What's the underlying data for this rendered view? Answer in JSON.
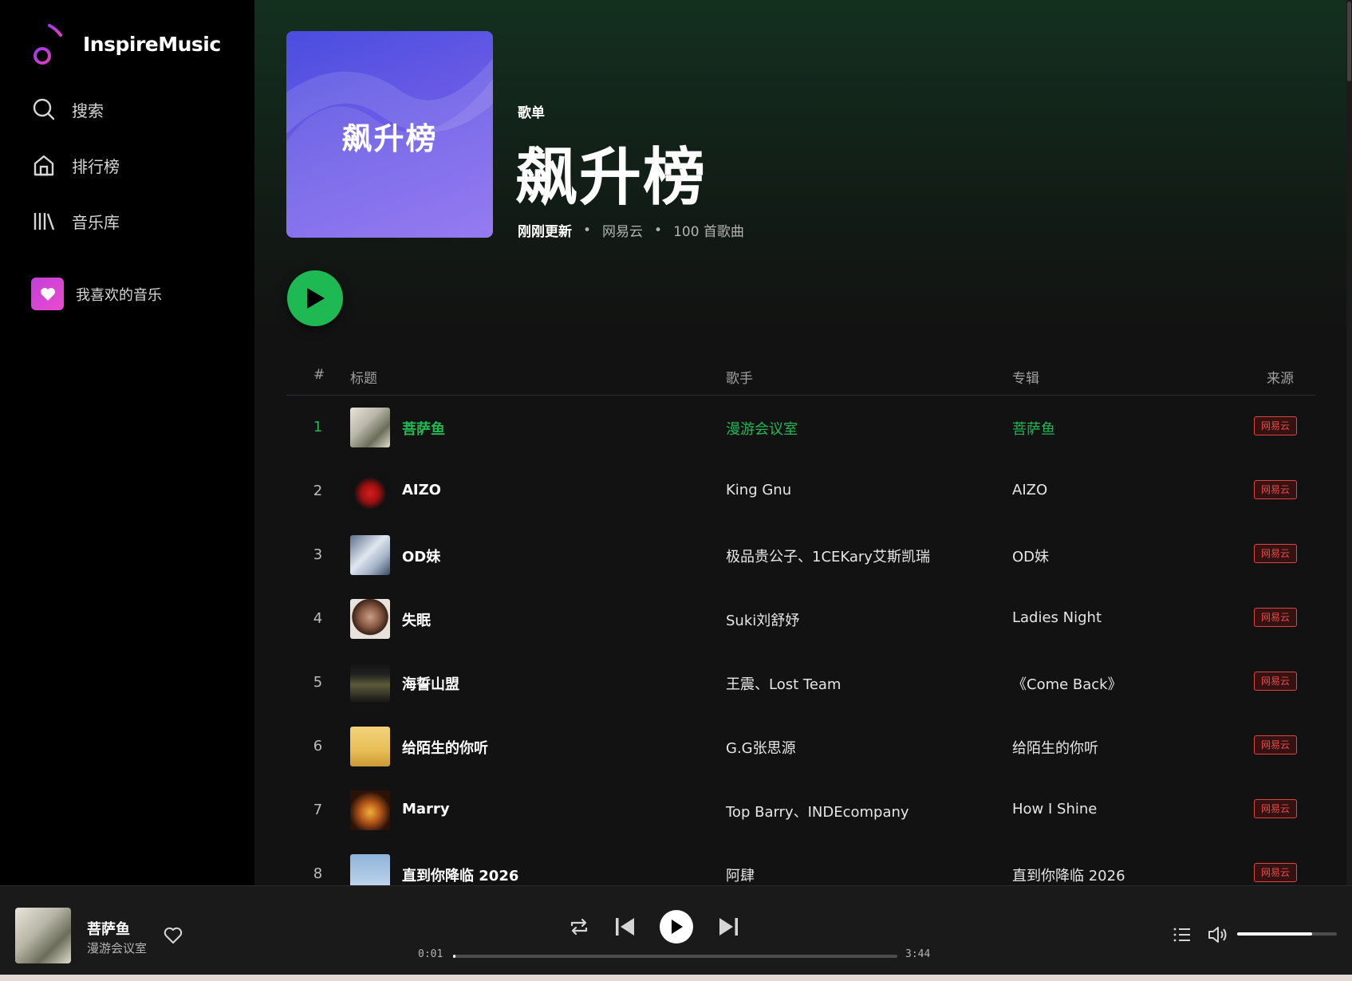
{
  "app": {
    "name": "InspireMusic"
  },
  "sidebar": {
    "nav": [
      {
        "label": "搜索",
        "icon": "search-icon"
      },
      {
        "label": "排行榜",
        "icon": "home-icon"
      },
      {
        "label": "音乐库",
        "icon": "library-icon"
      }
    ],
    "favorite": {
      "label": "我喜欢的音乐",
      "icon": "heart-icon"
    }
  },
  "playlist": {
    "cover_text": "飙升榜",
    "kind": "歌单",
    "title": "飙升榜",
    "updated": "刚刚更新",
    "source": "网易云",
    "count": "100 首歌曲"
  },
  "table": {
    "headers": {
      "num": "#",
      "title": "标题",
      "artist": "歌手",
      "album": "专辑",
      "source": "来源"
    },
    "rows": [
      {
        "num": "1",
        "title": "菩萨鱼",
        "artist": "漫游会议室",
        "album": "菩萨鱼",
        "source": "网易云"
      },
      {
        "num": "2",
        "title": "AIZO",
        "artist": "King Gnu",
        "album": "AIZO",
        "source": "网易云"
      },
      {
        "num": "3",
        "title": "OD妹",
        "artist": "极品贵公子、1CEKary艾斯凯瑞",
        "album": "OD妹",
        "source": "网易云"
      },
      {
        "num": "4",
        "title": "失眠",
        "artist": "Suki刘舒妤",
        "album": "Ladies Night",
        "source": "网易云"
      },
      {
        "num": "5",
        "title": "海誓山盟",
        "artist": "王震、Lost Team",
        "album": "《Come Back》",
        "source": "网易云"
      },
      {
        "num": "6",
        "title": "给陌生的你听",
        "artist": "G.G张思源",
        "album": "给陌生的你听",
        "source": "网易云"
      },
      {
        "num": "7",
        "title": "Marry",
        "artist": "Top Barry、INDEcompany",
        "album": "How I Shine",
        "source": "网易云"
      },
      {
        "num": "8",
        "title": "直到你降临 2026",
        "artist": "阿肆",
        "album": "直到你降临 2026",
        "source": "网易云"
      }
    ]
  },
  "player": {
    "title": "菩萨鱼",
    "artist": "漫游会议室",
    "current_time": "0:01",
    "total_time": "3:44",
    "progress_fraction": 0.005,
    "volume_fraction": 0.75
  },
  "colors": {
    "accent": "#1fb954",
    "source_badge": "#e84c45",
    "background": "#121212"
  }
}
